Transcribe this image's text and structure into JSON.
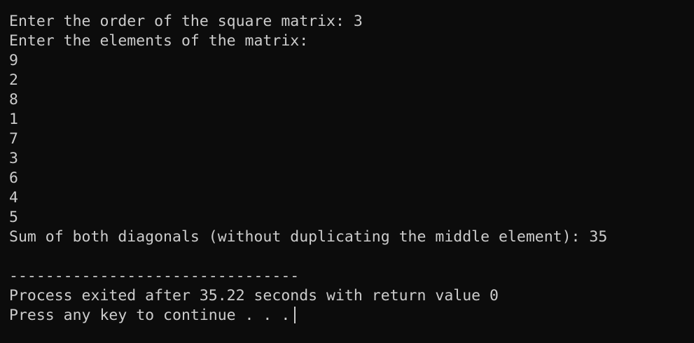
{
  "console": {
    "lines": {
      "0": "Enter the order of the square matrix: 3",
      "1": "Enter the elements of the matrix:",
      "2": "9",
      "3": "2",
      "4": "8",
      "5": "1",
      "6": "7",
      "7": "3",
      "8": "6",
      "9": "4",
      "10": "5",
      "11": "Sum of both diagonals (without duplicating the middle element): 35",
      "12": "",
      "13": "--------------------------------",
      "14": "Process exited after 35.22 seconds with return value 0",
      "15": "Press any key to continue . . ."
    }
  },
  "colors": {
    "background": "#0c0c0c",
    "foreground": "#cccccc"
  }
}
